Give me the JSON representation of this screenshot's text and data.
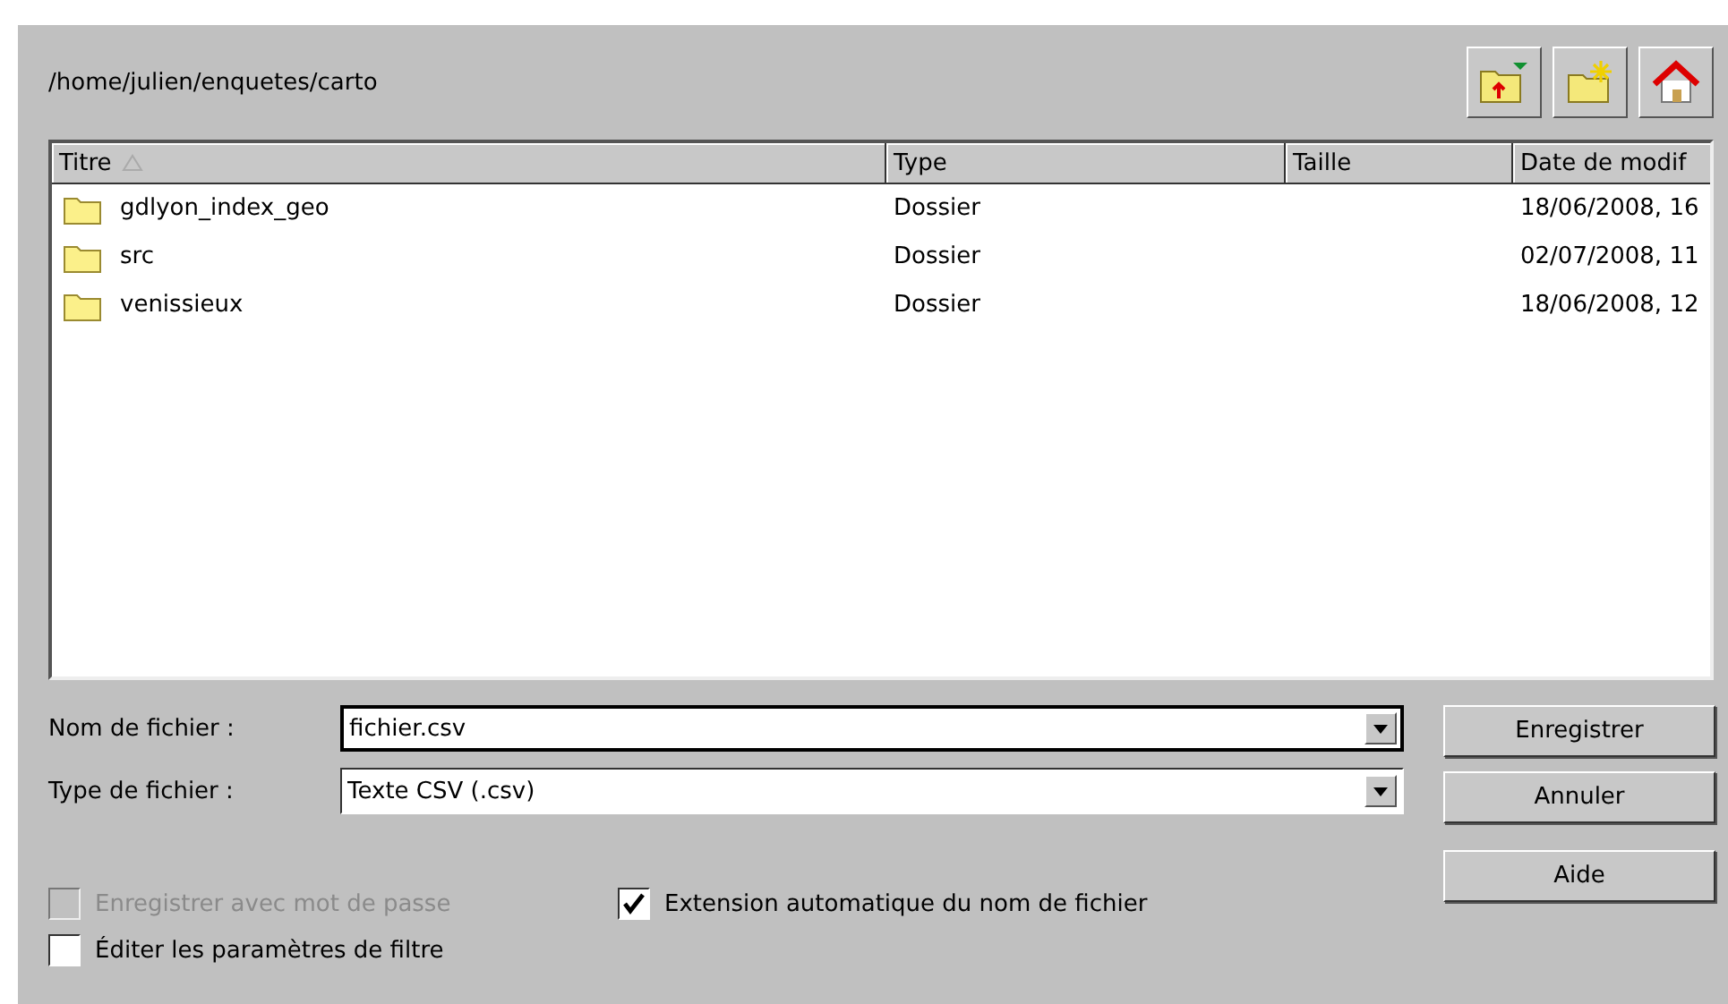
{
  "path": "/home/julien/enquetes/carto",
  "toolbar": [
    {
      "kind": "up"
    },
    {
      "kind": "new-folder"
    },
    {
      "kind": "home"
    }
  ],
  "file_list": {
    "columns": [
      {
        "label": "Titre",
        "sorted": true
      },
      {
        "label": "Type",
        "sorted": false
      },
      {
        "label": "Taille",
        "sorted": false
      },
      {
        "label": "Date de modif",
        "sorted": false
      }
    ],
    "rows": [
      {
        "name": "gdlyon_index_geo",
        "type": "Dossier",
        "size": "",
        "date": "18/06/2008, 16"
      },
      {
        "name": "src",
        "type": "Dossier",
        "size": "",
        "date": "02/07/2008, 11"
      },
      {
        "name": "venissieux",
        "type": "Dossier",
        "size": "",
        "date": "18/06/2008, 12"
      }
    ]
  },
  "fields": [
    {
      "label": "Nom de fichier :",
      "value": "fichier.csv",
      "focused": true
    },
    {
      "label": "Type de fichier :",
      "value": "Texte CSV (.csv)",
      "focused": false
    }
  ],
  "buttons": [
    "Enregistrer",
    "Annuler",
    "Aide"
  ],
  "options": [
    {
      "label": "Enregistrer avec mot de passe",
      "checked": false,
      "disabled": true
    },
    {
      "label": "Extension automatique du nom de fichier",
      "checked": true,
      "disabled": false
    },
    {
      "label": "Éditer les paramètres de filtre",
      "checked": false,
      "disabled": false
    }
  ]
}
